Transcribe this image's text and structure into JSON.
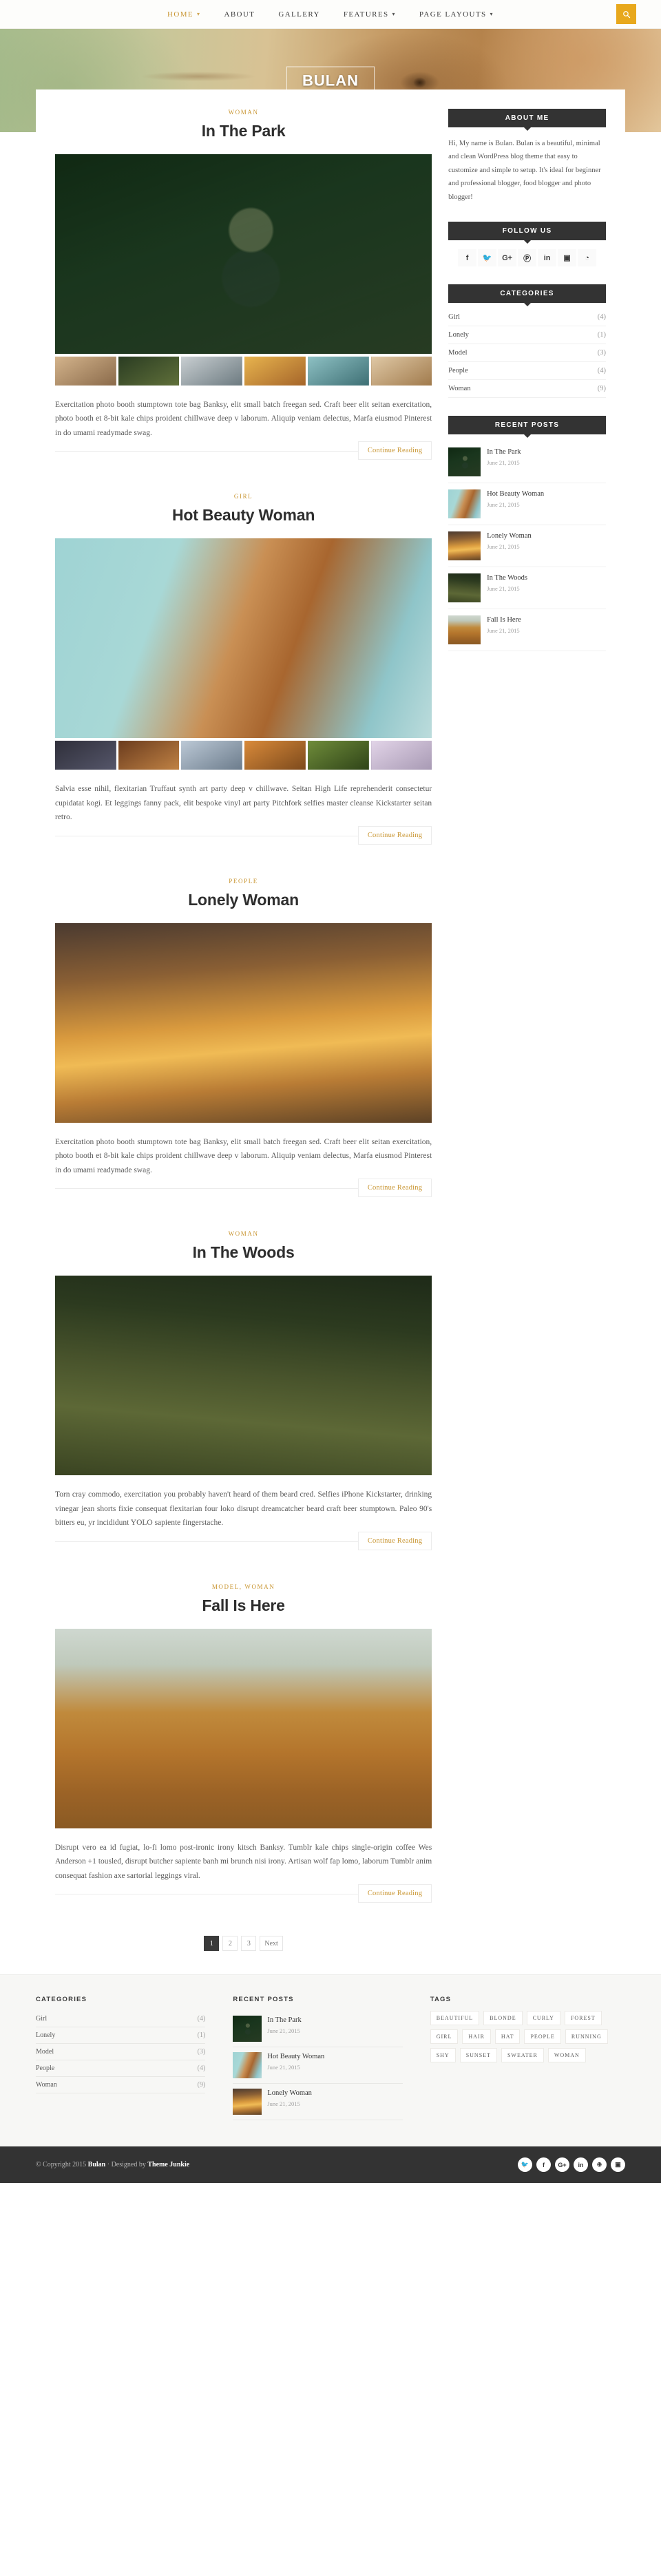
{
  "nav": {
    "items": [
      {
        "label": "HOME",
        "caret": true,
        "active": true
      },
      {
        "label": "ABOUT",
        "caret": false,
        "active": false
      },
      {
        "label": "GALLERY",
        "caret": false,
        "active": false
      },
      {
        "label": "FEATURES",
        "caret": true,
        "active": false
      },
      {
        "label": "PAGE LAYOUTS",
        "caret": true,
        "active": false
      }
    ],
    "search_icon": "search-icon",
    "accent": "#c99633",
    "search_bg": "#e8a81c"
  },
  "hero": {
    "logo": "BULAN"
  },
  "posts": [
    {
      "category": "WOMAN",
      "title": "In The Park",
      "image_class": "img-park",
      "thumbs": [
        "t1",
        "t2",
        "t3",
        "t4",
        "t5",
        "t6"
      ],
      "body": "Exercitation photo booth stumptown tote bag Banksy, elit small batch freegan sed. Craft beer elit seitan exercitation, photo booth et 8-bit kale chips proident chillwave deep v laborum. Aliquip veniam delectus, Marfa eiusmod Pinterest in do umami readymade swag.",
      "more": "Continue Reading"
    },
    {
      "category": "GIRL",
      "title": "Hot Beauty Woman",
      "image_class": "img-hot",
      "thumbs": [
        "t7",
        "t8",
        "t9",
        "t10",
        "t11",
        "t12"
      ],
      "body": "Salvia esse nihil, flexitarian Truffaut synth art party deep v chillwave. Seitan High Life reprehenderit consectetur cupidatat kogi. Et leggings fanny pack, elit bespoke vinyl art party Pitchfork selfies master cleanse Kickstarter seitan retro.",
      "more": "Continue Reading"
    },
    {
      "category": "PEOPLE",
      "title": "Lonely Woman",
      "image_class": "img-lonely",
      "thumbs": [],
      "body": "Exercitation photo booth stumptown tote bag Banksy, elit small batch freegan sed. Craft beer elit seitan exercitation, photo booth et 8-bit kale chips proident chillwave deep v laborum. Aliquip veniam delectus, Marfa eiusmod Pinterest in do umami readymade swag.",
      "more": "Continue Reading"
    },
    {
      "category": "WOMAN",
      "title": "In The Woods",
      "image_class": "img-woods",
      "thumbs": [],
      "body": "Torn cray commodo, exercitation you probably haven't heard of them beard cred. Selfies iPhone Kickstarter, drinking vinegar jean shorts fixie consequat flexitarian four loko disrupt dreamcatcher beard craft beer stumptown. Paleo 90's bitters eu, yr incididunt YOLO sapiente fingerstache.",
      "more": "Continue Reading"
    },
    {
      "category": "MODEL, WOMAN",
      "title": "Fall Is Here",
      "image_class": "img-fall",
      "thumbs": [],
      "body": "Disrupt vero ea id fugiat, lo-fi lomo post-ironic irony kitsch Banksy. Tumblr kale chips single-origin coffee Wes Anderson +1 tousled, disrupt butcher sapiente banh mi brunch nisi irony. Artisan wolf fap lomo, laborum Tumblr anim consequat fashion axe sartorial leggings viral.",
      "more": "Continue Reading"
    }
  ],
  "pagination": {
    "pages": [
      "1",
      "2",
      "3"
    ],
    "current": "1",
    "next": "Next"
  },
  "sidebar": {
    "about": {
      "title": "ABOUT ME",
      "text": "Hi, My name is Bulan. Bulan is a beautiful, minimal and clean WordPress blog theme that easy to customize and simple to setup. It's ideal for beginner and professional blogger, food blogger and photo blogger!"
    },
    "follow": {
      "title": "FOLLOW US",
      "icons": [
        {
          "name": "facebook-icon",
          "glyph": "f"
        },
        {
          "name": "twitter-icon",
          "glyph": "🐦"
        },
        {
          "name": "google-plus-icon",
          "glyph": "G+"
        },
        {
          "name": "pinterest-icon",
          "glyph": "Ⓟ"
        },
        {
          "name": "linkedin-icon",
          "glyph": "in"
        },
        {
          "name": "instagram-icon",
          "glyph": "▣"
        },
        {
          "name": "rss-icon",
          "glyph": "◔"
        }
      ]
    },
    "categories": {
      "title": "CATEGORIES",
      "items": [
        {
          "label": "Girl",
          "count": "(4)"
        },
        {
          "label": "Lonely",
          "count": "(1)"
        },
        {
          "label": "Model",
          "count": "(3)"
        },
        {
          "label": "People",
          "count": "(4)"
        },
        {
          "label": "Woman",
          "count": "(9)"
        }
      ]
    },
    "recent": {
      "title": "RECENT POSTS",
      "items": [
        {
          "title": "In The Park",
          "date": "June 21, 2015",
          "thumb": "img-park"
        },
        {
          "title": "Hot Beauty Woman",
          "date": "June 21, 2015",
          "thumb": "img-hot"
        },
        {
          "title": "Lonely Woman",
          "date": "June 21, 2015",
          "thumb": "img-lonely"
        },
        {
          "title": "In The Woods",
          "date": "June 21, 2015",
          "thumb": "img-woods"
        },
        {
          "title": "Fall Is Here",
          "date": "June 21, 2015",
          "thumb": "img-fall"
        }
      ]
    }
  },
  "footer": {
    "categories": {
      "title": "CATEGORIES",
      "items": [
        {
          "label": "Girl",
          "count": "(4)"
        },
        {
          "label": "Lonely",
          "count": "(1)"
        },
        {
          "label": "Model",
          "count": "(3)"
        },
        {
          "label": "People",
          "count": "(4)"
        },
        {
          "label": "Woman",
          "count": "(9)"
        }
      ]
    },
    "recent": {
      "title": "RECENT POSTS",
      "items": [
        {
          "title": "In The Park",
          "date": "June 21, 2015",
          "thumb": "img-park"
        },
        {
          "title": "Hot Beauty Woman",
          "date": "June 21, 2015",
          "thumb": "img-hot"
        },
        {
          "title": "Lonely Woman",
          "date": "June 21, 2015",
          "thumb": "img-lonely"
        }
      ]
    },
    "tags": {
      "title": "TAGS",
      "items": [
        "BEAUTIFUL",
        "BLONDE",
        "CURLY",
        "FOREST",
        "GIRL",
        "HAIR",
        "HAT",
        "PEOPLE",
        "RUNNING",
        "SHY",
        "SUNSET",
        "SWEATER",
        "WOMAN"
      ]
    },
    "copyright_prefix": "© Copyright 2015 ",
    "copyright_brand": "Bulan",
    "copyright_mid": " · Designed by ",
    "copyright_author": "Theme Junkie",
    "social": [
      {
        "name": "twitter-icon",
        "glyph": "🐦"
      },
      {
        "name": "facebook-icon",
        "glyph": "f"
      },
      {
        "name": "google-plus-icon",
        "glyph": "G+"
      },
      {
        "name": "linkedin-icon",
        "glyph": "in"
      },
      {
        "name": "dribbble-icon",
        "glyph": "⊕"
      },
      {
        "name": "instagram-icon",
        "glyph": "▣"
      }
    ]
  }
}
